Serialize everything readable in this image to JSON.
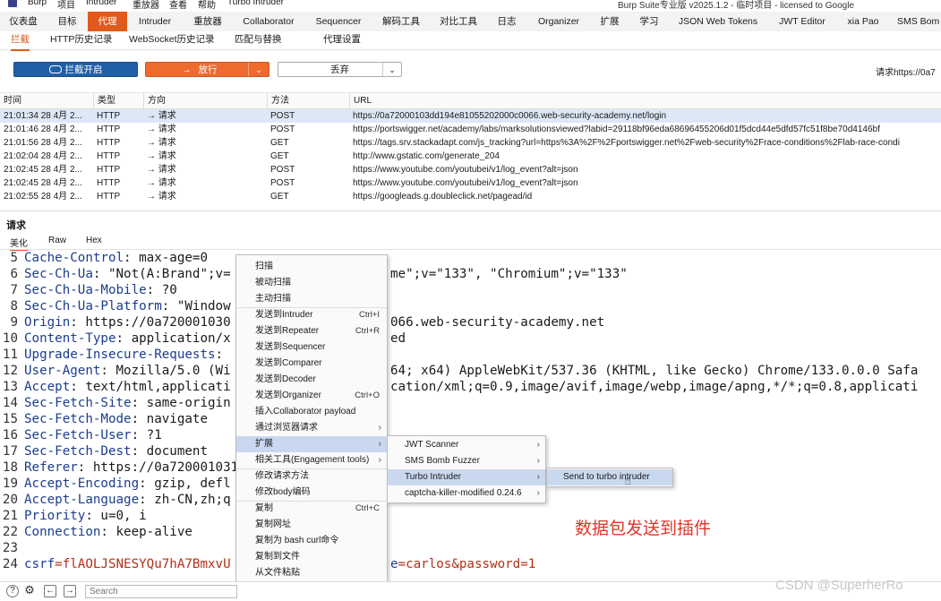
{
  "menubar": {
    "items": [
      "Burp",
      "项目",
      "Intruder",
      "重放器",
      "查看",
      "帮助",
      "Turbo Intruder"
    ],
    "window_title": "Burp Suite专业版  v2025.1.2 - 临时项目 - licensed to Google"
  },
  "main_tabs": [
    "仪表盘",
    "目标",
    "代理",
    "Intruder",
    "重放器",
    "Collaborator",
    "Sequencer",
    "解码工具",
    "对比工具",
    "日志",
    "Organizer",
    "扩展",
    "学习",
    "JSON Web Tokens",
    "JWT Editor",
    "xia Pao",
    "SMS Bom"
  ],
  "sub_tabs": [
    "拦截",
    "HTTP历史记录",
    "WebSocket历史记录",
    "匹配与替换",
    "代理设置"
  ],
  "toolbar": {
    "intercept_label": "拦截开启",
    "forward_label": "放行",
    "drop_label": "丢弃",
    "request_to_label": "请求https://0a7"
  },
  "history": {
    "headers": [
      "时间",
      "类型",
      "方向",
      "方法",
      "URL"
    ],
    "rows": [
      {
        "time": "21:01:34 28 4月 2...",
        "type": "HTTP",
        "dir": "→  请求",
        "method": "POST",
        "url": "https://0a72000103dd194e81055202000c0066.web-security-academy.net/login"
      },
      {
        "time": "21:01:46 28 4月 2...",
        "type": "HTTP",
        "dir": "→  请求",
        "method": "POST",
        "url": "https://portswigger.net/academy/labs/marksolutionsviewed?labid=29118bf96eda68696455206d01f5dcd44e5dfd57fc51f8be70d4146bf"
      },
      {
        "time": "21:01:56 28 4月 2...",
        "type": "HTTP",
        "dir": "→  请求",
        "method": "GET",
        "url": "https://tags.srv.stackadapt.com/js_tracking?url=https%3A%2F%2Fportswigger.net%2Fweb-security%2Frace-conditions%2Flab-race-condi"
      },
      {
        "time": "21:02:04 28 4月 2...",
        "type": "HTTP",
        "dir": "→  请求",
        "method": "GET",
        "url": "http://www.gstatic.com/generate_204"
      },
      {
        "time": "21:02:45 28 4月 2...",
        "type": "HTTP",
        "dir": "→  请求",
        "method": "POST",
        "url": "https://www.youtube.com/youtubei/v1/log_event?alt=json"
      },
      {
        "time": "21:02:45 28 4月 2...",
        "type": "HTTP",
        "dir": "→  请求",
        "method": "POST",
        "url": "https://www.youtube.com/youtubei/v1/log_event?alt=json"
      },
      {
        "time": "21:02:55 28 4月 2...",
        "type": "HTTP",
        "dir": "→  请求",
        "method": "GET",
        "url": "https://googleads.g.doubleclick.net/pagead/id"
      }
    ]
  },
  "request_panel": {
    "title": "请求",
    "tabs": [
      "美化",
      "Raw",
      "Hex"
    ]
  },
  "editor_lines": [
    {
      "n": "5",
      "k": "Cache-Control",
      "v": ": max-age=0"
    },
    {
      "n": "6",
      "k": "Sec-Ch-Ua",
      "v": ": \"Not(A:Brand\";v=",
      "tail": "me\";v=\"133\", \"Chromium\";v=\"133\""
    },
    {
      "n": "7",
      "k": "Sec-Ch-Ua-Mobile",
      "v": ": ?0",
      "tail": ""
    },
    {
      "n": "8",
      "k": "Sec-Ch-Ua-Platform",
      "v": ": \"Window",
      "tail": ""
    },
    {
      "n": "9",
      "k": "Origin",
      "v": ": https://0a720001030",
      "tail": "066.web-security-academy.net"
    },
    {
      "n": "10",
      "k": "Content-Type",
      "v": ": application/x",
      "tail": "ed"
    },
    {
      "n": "11",
      "k": "Upgrade-Insecure-Requests",
      "v": ":",
      "tail": ""
    },
    {
      "n": "12",
      "k": "User-Agent",
      "v": ": Mozilla/5.0 (Wi",
      "tail": "64; x64) AppleWebKit/537.36 (KHTML, like Gecko) Chrome/133.0.0.0 Safa"
    },
    {
      "n": "13",
      "k": "Accept",
      "v": ": text/html,applicati",
      "tail": "cation/xml;q=0.9,image/avif,image/webp,image/apng,*/*;q=0.8,applicati"
    },
    {
      "n": "14",
      "k": "Sec-Fetch-Site",
      "v": ": same-origin",
      "tail": ""
    },
    {
      "n": "15",
      "k": "Sec-Fetch-Mode",
      "v": ": navigate",
      "tail": ""
    },
    {
      "n": "16",
      "k": "Sec-Fetch-User",
      "v": ": ?1",
      "tail": ""
    },
    {
      "n": "17",
      "k": "Sec-Fetch-Dest",
      "v": ": document",
      "tail": ""
    },
    {
      "n": "18",
      "k": "Referer",
      "v": ": https://0a720001031",
      "tail": ""
    },
    {
      "n": "19",
      "k": "Accept-Encoding",
      "v": ": gzip, defl",
      "tail": ""
    },
    {
      "n": "20",
      "k": "Accept-Language",
      "v": ": zh-CN,zh;q",
      "tail": ""
    },
    {
      "n": "21",
      "k": "Priority",
      "v": ": u=0, i",
      "tail": ""
    },
    {
      "n": "22",
      "k": "Connection",
      "v": ": keep-alive",
      "tail": ""
    },
    {
      "n": "23",
      "k": "",
      "v": "",
      "tail": ""
    }
  ],
  "body_line": {
    "n": "24",
    "k1": "csrf",
    "v1": "=flAOLJSNESYQu7hA7BmxvU",
    "tail_k": "e",
    "tail_v": "=carlos&password=1"
  },
  "context_menu": {
    "items": [
      {
        "label": "扫描",
        "shortcut": ""
      },
      {
        "label": "被动扫描",
        "shortcut": ""
      },
      {
        "label": "主动扫描",
        "shortcut": ""
      },
      {
        "label": "发送到Intruder",
        "shortcut": "Ctrl+I"
      },
      {
        "label": "发送到Repeater",
        "shortcut": "Ctrl+R"
      },
      {
        "label": "发送到Sequencer",
        "shortcut": ""
      },
      {
        "label": "发送到Comparer",
        "shortcut": ""
      },
      {
        "label": "发送到Decoder",
        "shortcut": ""
      },
      {
        "label": "发送到Organizer",
        "shortcut": "Ctrl+O"
      },
      {
        "label": "插入Collaborator payload",
        "shortcut": ""
      },
      {
        "label": "通过浏览器请求",
        "shortcut": ""
      },
      {
        "label": "扩展",
        "shortcut": ""
      },
      {
        "label": "相关工具(Engagement tools)",
        "shortcut": ""
      },
      {
        "label": "修改请求方法",
        "shortcut": ""
      },
      {
        "label": "修改body编码",
        "shortcut": ""
      },
      {
        "label": "复制",
        "shortcut": "Ctrl+C"
      },
      {
        "label": "复制网址",
        "shortcut": ""
      },
      {
        "label": "复制为 bash curl命令",
        "shortcut": ""
      },
      {
        "label": "复制到文件",
        "shortcut": ""
      },
      {
        "label": "从文件粘贴",
        "shortcut": ""
      },
      {
        "label": "保存条目",
        "shortcut": ""
      }
    ]
  },
  "extensions_submenu": [
    "JWT Scanner",
    "SMS Bomb Fuzzer",
    "Turbo Intruder",
    "captcha-killer-modified 0.24.6"
  ],
  "turbo_submenu": [
    "Send to turbo intruder"
  ],
  "annotation": "数据包发送到插件",
  "search": {
    "placeholder": "Search"
  },
  "watermark": "CSDN @SuperherRo",
  "colors": {
    "accent": "#e05a1c",
    "intercept_button": "#1f5fa8",
    "annotation": "#e4342a",
    "selection": "#c9d8ef"
  }
}
